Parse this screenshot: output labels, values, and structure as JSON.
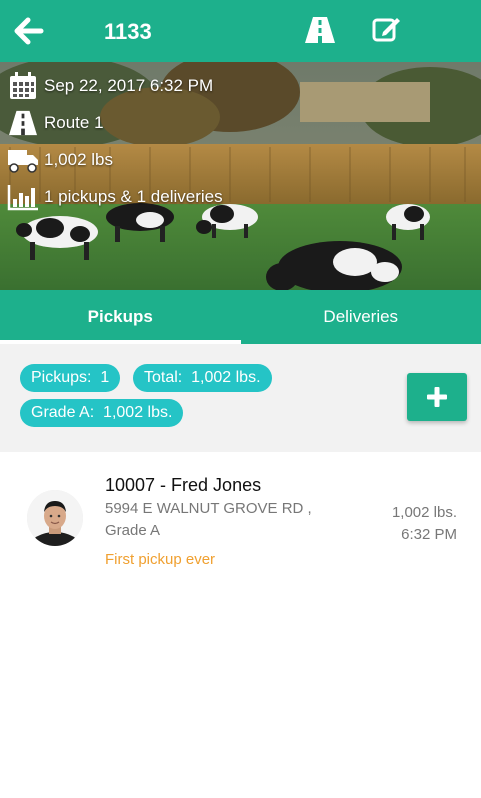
{
  "header": {
    "title": "1133",
    "back_icon": "arrow-left-icon",
    "route_icon": "road-icon",
    "edit_icon": "edit-icon"
  },
  "hero": {
    "date": "Sep 22, 2017 6:32 PM",
    "route": "Route 1",
    "weight": "1,002 lbs",
    "summary": "1 pickups & 1 deliveries"
  },
  "tabs": [
    {
      "label": "Pickups",
      "active": true
    },
    {
      "label": "Deliveries",
      "active": false
    }
  ],
  "summary": {
    "pickups_label": "Pickups:",
    "pickups_value": "1",
    "total_label": "Total:",
    "total_value": "1,002 lbs.",
    "grade_label": "Grade A:",
    "grade_value": "1,002 lbs."
  },
  "pickups": [
    {
      "name": "10007 - Fred Jones",
      "address": "5994 E WALNUT GROVE RD ,",
      "grade": "Grade A",
      "note": "First pickup ever",
      "weight": "1,002 lbs.",
      "time": "6:32 PM"
    }
  ],
  "colors": {
    "primary": "#1db08c",
    "chip": "#25c4c6",
    "note": "#f0a030"
  }
}
